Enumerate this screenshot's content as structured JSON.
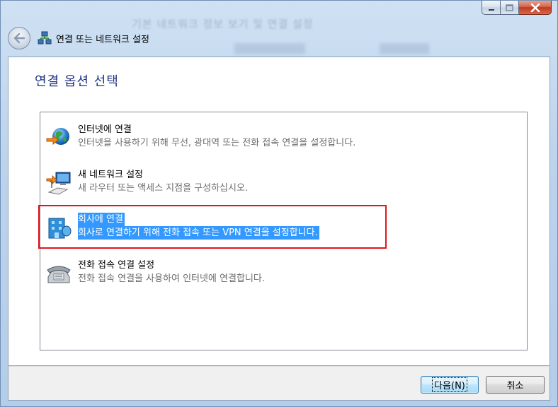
{
  "window": {
    "background_title": "기본 네트워크 정보 보기 및 연결 설정",
    "caption_buttons": {
      "minimize": "minimize-icon",
      "maximize": "maximize-icon",
      "close": "close-icon"
    }
  },
  "header": {
    "back_icon": "back-arrow-icon",
    "title": "연결 또는 네트워크 설정"
  },
  "main": {
    "page_title": "연결 옵션 선택",
    "options": [
      {
        "title": "인터넷에 연결",
        "description": "인터넷을 사용하기 위해 무선, 광대역 또는 전화 접속 연결을 설정합니다.",
        "icon": "globe-connect-icon",
        "selected": false
      },
      {
        "title": "새 네트워크 설정",
        "description": "새 라우터 또는 액세스 지점을 구성하십시오.",
        "icon": "network-setup-icon",
        "selected": false
      },
      {
        "title": "회사에 연결",
        "description": "회사로 연결하기 위해 전화 접속 또는 VPN 연결을 설정합니다.",
        "icon": "workplace-icon",
        "selected": true
      },
      {
        "title": "전화 접속 연결 설정",
        "description": "전화 접속 연결을 사용하여 인터넷에 연결합니다.",
        "icon": "dialup-phone-icon",
        "selected": false
      }
    ]
  },
  "footer": {
    "next_label": "다음(N)",
    "cancel_label": "취소"
  },
  "colors": {
    "title_blue": "#1e3287",
    "selection": "#3399ff",
    "highlight_frame": "#e0161c"
  }
}
